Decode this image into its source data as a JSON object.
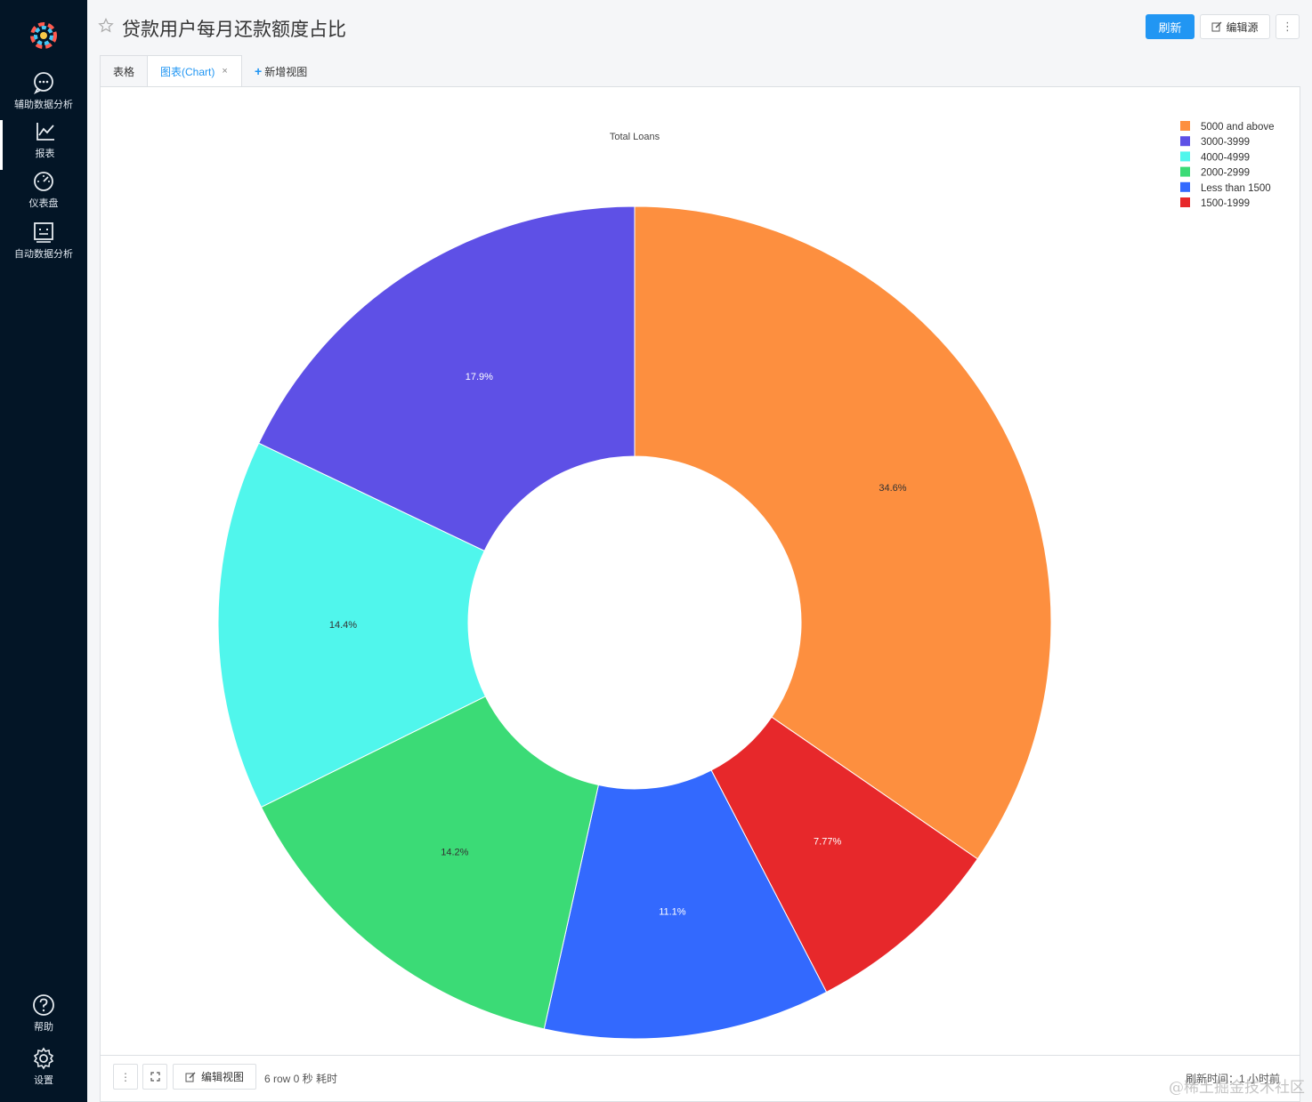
{
  "sidebar": {
    "items": [
      {
        "label": "辅助数据分析",
        "icon": "chat-bubble-icon"
      },
      {
        "label": "报表",
        "icon": "line-chart-icon"
      },
      {
        "label": "仪表盘",
        "icon": "gauge-icon"
      },
      {
        "label": "自动数据分析",
        "icon": "robot-icon"
      }
    ],
    "bottom": [
      {
        "label": "帮助",
        "icon": "help-icon"
      },
      {
        "label": "设置",
        "icon": "gear-icon"
      }
    ]
  },
  "header": {
    "title": "贷款用户每月还款额度占比",
    "refresh_label": "刷新",
    "edit_source_label": "编辑源",
    "more_label": "⋮"
  },
  "tabs": {
    "table": "表格",
    "chart": "图表(Chart)",
    "chart_close": "×",
    "add": "新增视图"
  },
  "footer": {
    "more_label": "⋮",
    "edit_view_label": "编辑视图",
    "row_info": "6 row 0 秒 耗时",
    "refresh_time": "刷新时间：1 小时前"
  },
  "watermark": "@稀土掘金技术社区",
  "chart_data": {
    "type": "pie",
    "subtype": "donut",
    "title": "Total Loans",
    "legend_position": "top-right",
    "slices": [
      {
        "label": "5000 and above",
        "value": 34.6,
        "text": "34.6%",
        "color": "#fd8f3f"
      },
      {
        "label": "1500-1999",
        "value": 7.77,
        "text": "7.77%",
        "color": "#e7282b"
      },
      {
        "label": "Less than 1500",
        "value": 11.1,
        "text": "11.1%",
        "color": "#3369fe"
      },
      {
        "label": "2000-2999",
        "value": 14.2,
        "text": "14.2%",
        "color": "#3bdb76"
      },
      {
        "label": "4000-4999",
        "value": 14.4,
        "text": "14.4%",
        "color": "#50f6ec"
      },
      {
        "label": "3000-3999",
        "value": 17.9,
        "text": "17.9%",
        "color": "#5e50e6"
      }
    ],
    "legend_order": [
      "5000 and above",
      "3000-3999",
      "4000-4999",
      "2000-2999",
      "Less than 1500",
      "1500-1999"
    ]
  }
}
